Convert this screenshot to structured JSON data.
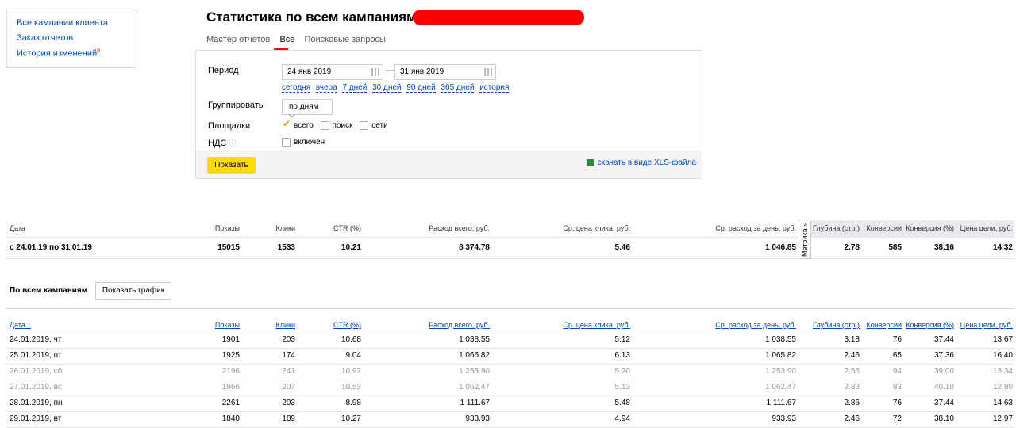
{
  "sidenav": {
    "items": [
      "Все кампании клиента",
      "Заказ отчетов",
      "История изменений"
    ],
    "badge": "β"
  },
  "header": {
    "title": "Статистика по всем кампаниям:"
  },
  "tabs": [
    "Мастер отчетов",
    "Все",
    "Поисковые запросы"
  ],
  "filters": {
    "period_label": "Период",
    "date_from": "24 янв 2019",
    "date_to": "31 янв 2019",
    "dash": "—",
    "quick": [
      "сегодня",
      "вчера",
      "7 дней",
      "30 дней",
      "90 дней",
      "365 дней",
      "история"
    ],
    "group_label": "Группировать",
    "group_value": "по дням ⌵",
    "platforms_label": "Площадки",
    "platforms": [
      "всего",
      "поиск",
      "сети"
    ],
    "vat_label": "НДС",
    "vat_option": "включен",
    "show_button": "Показать",
    "xls_link": "скачать в виде XLS-файла"
  },
  "summary": {
    "headers": [
      "Дата",
      "Показы",
      "Клики",
      "CTR (%)",
      "Расход всего, руб.",
      "Ср. цена клика, руб.",
      "Ср. расход за день, руб.",
      "Глубина (стр.)",
      "Конверсии",
      "Конверсия (%)",
      "Цена цели, руб."
    ],
    "row": [
      "с 24.01.19 по 31.01.19",
      "15015",
      "1533",
      "10.21",
      "8 374.78",
      "5.46",
      "1 046.85",
      "2.78",
      "585",
      "38.16",
      "14.32"
    ],
    "metrika_label": "Метрика »"
  },
  "daily": {
    "section_title": "По всем кампаниям",
    "graph_button": "Показать график",
    "headers": [
      "Дата ↑",
      "Показы",
      "Клики",
      "CTR (%)",
      "Расход всего, руб.",
      "Ср. цена клика, руб.",
      "Ср. расход за день, руб.",
      "Глубина (стр.)",
      "Конверсии",
      "Конверсия (%)",
      "Цена цели, руб."
    ],
    "rows": [
      [
        "24.01.2019, чт",
        "1901",
        "203",
        "10.68",
        "1 038.55",
        "5.12",
        "1 038.55",
        "3.18",
        "76",
        "37.44",
        "13.67"
      ],
      [
        "25.01.2019, пт",
        "1925",
        "174",
        "9.04",
        "1 065.82",
        "6.13",
        "1 065.82",
        "2.46",
        "65",
        "37.36",
        "16.40"
      ],
      [
        "26.01.2019, сб",
        "2196",
        "241",
        "10.97",
        "1 253.90",
        "5.20",
        "1 253.90",
        "2.55",
        "94",
        "39.00",
        "13.34"
      ],
      [
        "27.01.2019, вс",
        "1966",
        "207",
        "10.53",
        "1 062.47",
        "5.13",
        "1 062.47",
        "2.83",
        "83",
        "40.10",
        "12.80"
      ],
      [
        "28.01.2019, пн",
        "2261",
        "203",
        "8.98",
        "1 111.67",
        "5.48",
        "1 111.67",
        "2.86",
        "76",
        "37.44",
        "14.63"
      ],
      [
        "29.01.2019, вт",
        "1840",
        "189",
        "10.27",
        "933.93",
        "4.94",
        "933.93",
        "2.46",
        "72",
        "38.10",
        "12.97"
      ]
    ],
    "weekend_rows": [
      2,
      3
    ]
  }
}
